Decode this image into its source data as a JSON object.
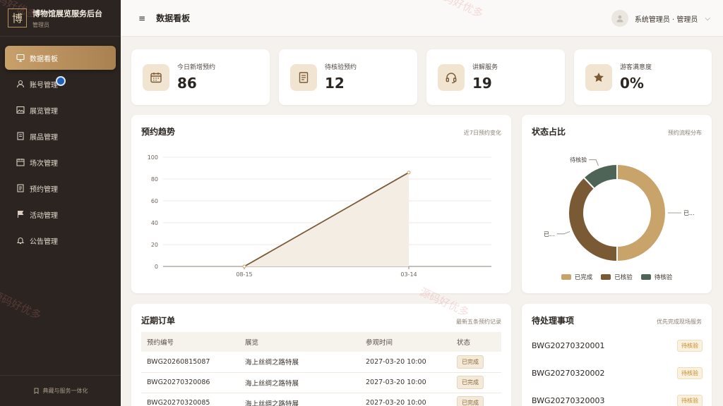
{
  "app": {
    "title": "博物馆展览服务后台",
    "role": "管理员",
    "logo_char": "博"
  },
  "sidebar": {
    "items": [
      {
        "label": "数据看板",
        "icon": "dashboard-icon",
        "active": true
      },
      {
        "label": "账号管理",
        "icon": "user-icon",
        "active": false
      },
      {
        "label": "展览管理",
        "icon": "image-icon",
        "active": false
      },
      {
        "label": "展品管理",
        "icon": "document-icon",
        "active": false
      },
      {
        "label": "场次管理",
        "icon": "calendar-icon",
        "active": false
      },
      {
        "label": "预约管理",
        "icon": "list-icon",
        "active": false
      },
      {
        "label": "活动管理",
        "icon": "flag-icon",
        "active": false
      },
      {
        "label": "公告管理",
        "icon": "bell-icon",
        "active": false
      }
    ],
    "footer": "典藏与服务一体化"
  },
  "header": {
    "title": "数据看板",
    "user": "系统管理员 · 管理员"
  },
  "stats": [
    {
      "label": "今日新增预约",
      "value": "86",
      "icon": "calendar-icon"
    },
    {
      "label": "待核验预约",
      "value": "12",
      "icon": "document-icon"
    },
    {
      "label": "讲解服务",
      "value": "19",
      "icon": "headset-icon"
    },
    {
      "label": "游客满意度",
      "value": "0%",
      "icon": "star-icon"
    }
  ],
  "trend": {
    "title": "预约趋势",
    "subtitle": "近7日预约变化",
    "chart_data": {
      "type": "area",
      "x": [
        "08-15",
        "03-14"
      ],
      "series": [
        {
          "values": [
            0,
            86
          ]
        }
      ],
      "ylim": [
        0,
        100
      ],
      "yticks": [
        0,
        20,
        40,
        60,
        80,
        100
      ],
      "grid": true,
      "colors": {
        "line": "#7a5a35",
        "fill": "#f4ede3"
      }
    }
  },
  "status": {
    "title": "状态占比",
    "subtitle": "预约流程分布",
    "chart_data": {
      "type": "pie",
      "donut": true,
      "slices": [
        {
          "name": "已完成",
          "value": 50,
          "color": "#c8a46a",
          "label": "已..."
        },
        {
          "name": "已核验",
          "value": 38,
          "color": "#7a5a35",
          "label": "已..."
        },
        {
          "name": "待核验",
          "value": 12,
          "color": "#4d6457",
          "label": "待核验"
        }
      ],
      "legend": "bottom"
    }
  },
  "orders": {
    "title": "近期订单",
    "subtitle": "最新五条预约记录",
    "columns": [
      "预约编号",
      "展览",
      "参观时间",
      "状态"
    ],
    "rows": [
      [
        "BWG20260815087",
        "海上丝绸之路特展",
        "2027-03-20 10:00",
        "已完成"
      ],
      [
        "BWG20270320086",
        "海上丝绸之路特展",
        "2027-03-20 10:00",
        "已完成"
      ],
      [
        "BWG20270320085",
        "海上丝绸之路特展",
        "2027-03-20 10:00",
        "已完成"
      ]
    ]
  },
  "todo": {
    "title": "待处理事项",
    "subtitle": "优先完成现场服务",
    "items": [
      {
        "id": "BWG20270320001",
        "status": "待核验"
      },
      {
        "id": "BWG20270320002",
        "status": "待核验"
      },
      {
        "id": "BWG20270320003",
        "status": "待核验"
      }
    ]
  },
  "watermark": "源码好优多"
}
